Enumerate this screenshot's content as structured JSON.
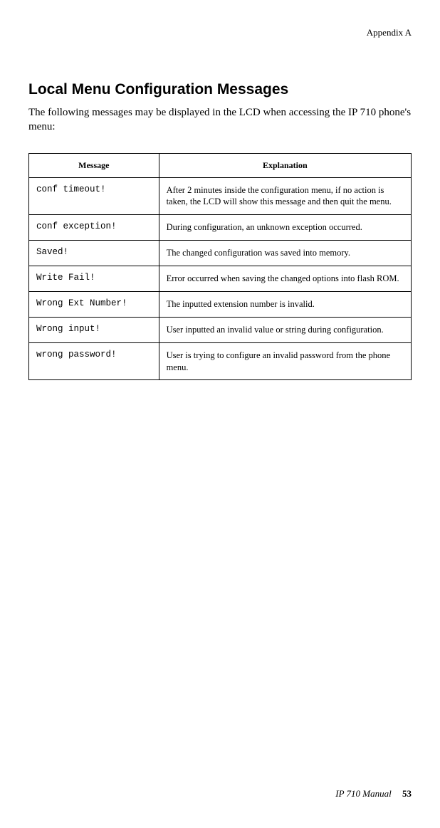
{
  "header": {
    "appendix": "Appendix A"
  },
  "section": {
    "title": "Local Menu Configuration Messages",
    "intro": "The following messages may be displayed in the LCD when accessing the IP 710 phone's menu:"
  },
  "table": {
    "headers": {
      "message": "Message",
      "explanation": "Explanation"
    },
    "rows": [
      {
        "message": "conf timeout!",
        "explanation": "After 2 minutes inside the configuration menu, if no action is taken, the LCD will show this message and then quit the menu."
      },
      {
        "message": "conf exception!",
        "explanation": "During configuration, an unknown exception occurred."
      },
      {
        "message": "Saved!",
        "explanation": "The changed configuration was saved into memory."
      },
      {
        "message": "Write Fail!",
        "explanation": "Error occurred when saving the changed options into flash ROM."
      },
      {
        "message": "Wrong Ext Number!",
        "explanation": "The inputted extension number is invalid."
      },
      {
        "message": "Wrong input!",
        "explanation": "User inputted an invalid value or string during configuration."
      },
      {
        "message": "wrong password!",
        "explanation": "User is trying to configure an invalid password from the phone menu."
      }
    ]
  },
  "footer": {
    "manual": "IP 710 Manual",
    "page": "53"
  }
}
